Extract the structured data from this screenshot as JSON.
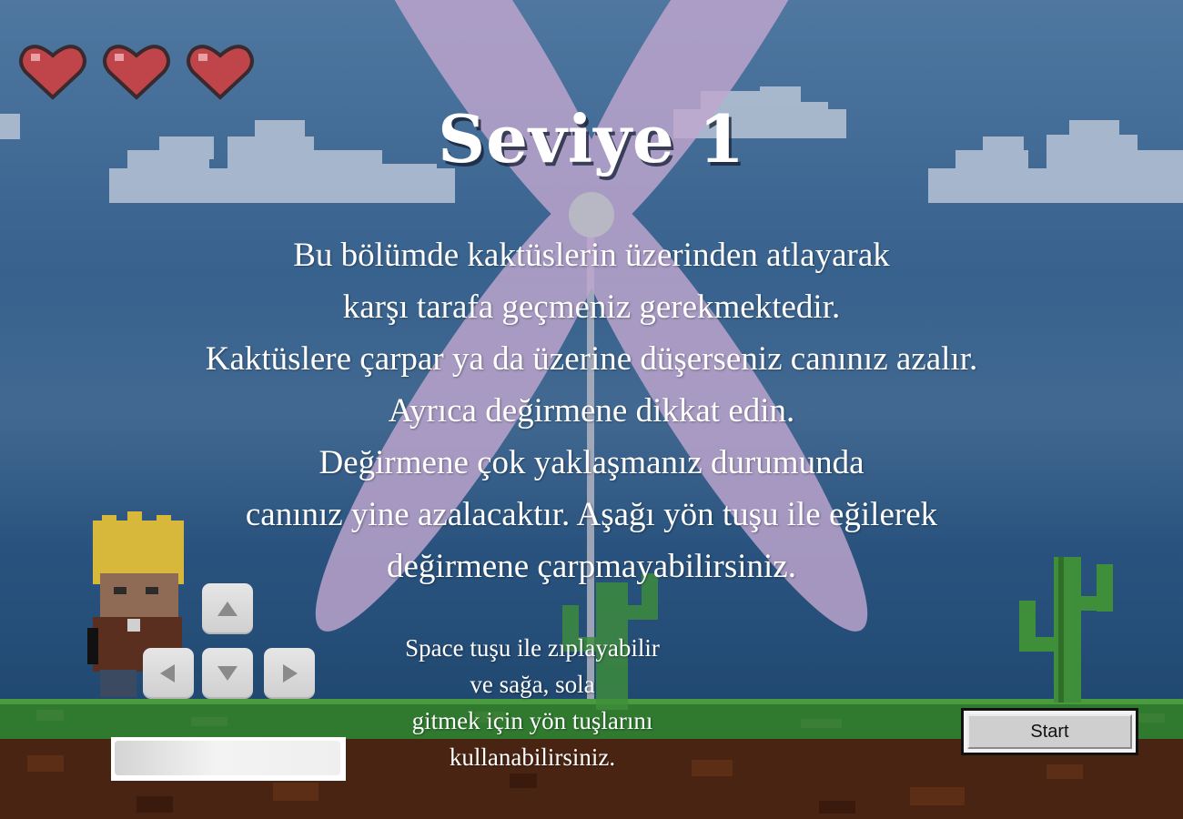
{
  "game": {
    "level_title": "Seviye 1",
    "lives": 3,
    "description_lines": [
      "Bu bölümde kaktüslerin üzerinden atlayarak",
      "karşı tarafa geçmeniz gerekmektedir.",
      "Kaktüslere çarpar ya da üzerine düşerseniz canınız azalır.",
      "Ayrıca değirmene dikkat edin.",
      "Değirmene çok yaklaşmanız durumunda",
      "canınız yine azalacaktır. Aşağı yön tuşu ile eğilerek",
      "değirmene çarpmayabilirsiniz."
    ],
    "controls_hint_lines": [
      "Space tuşu ile zıplayabilir",
      "ve sağa, sola",
      "gitmek için yön tuşlarını",
      "kullanabilirsiniz."
    ]
  },
  "arrow_keys": {
    "up": "up-arrow-icon",
    "left": "left-arrow-icon",
    "down": "down-arrow-icon",
    "right": "right-arrow-icon"
  },
  "name_input": {
    "value": "",
    "placeholder": ""
  },
  "start_button": {
    "label": "Start"
  },
  "colors": {
    "sky_top": "#4f77a0",
    "sky_bottom": "#204870",
    "heart": "#c0454b",
    "windmill_blade": "#b9a3c9",
    "grass": "#2f7a2f",
    "dirt": "#4a2412",
    "cactus": "#3f8f3a"
  }
}
